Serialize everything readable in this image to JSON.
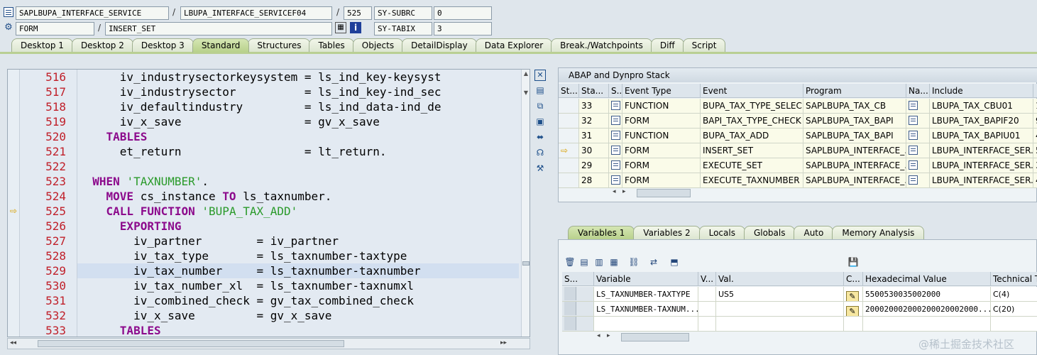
{
  "header": {
    "row1": {
      "program": "SAPLBUPA_INTERFACE_SERVICE",
      "include": "LBUPA_INTERFACE_SERVICEF04",
      "line": "525",
      "sysvar_name": "SY-SUBRC",
      "sysvar_value": "0"
    },
    "row2": {
      "event_type": "FORM",
      "event_name": "INSERT_SET",
      "sysvar_name": "SY-TABIX",
      "sysvar_value": "3"
    },
    "separator": "/"
  },
  "main_tabs": [
    "Desktop 1",
    "Desktop 2",
    "Desktop 3",
    "Standard",
    "Structures",
    "Tables",
    "Objects",
    "DetailDisplay",
    "Data Explorer",
    "Break./Watchpoints",
    "Diff",
    "Script"
  ],
  "active_main_tab": "Standard",
  "editor": {
    "current_line": "525",
    "cursor_line": "529",
    "lines": [
      {
        "no": "516",
        "code": "      iv_industrysectorkeysystem = ls_ind_key-keysyst"
      },
      {
        "no": "517",
        "code": "      iv_industrysector          = ls_ind_key-ind_sec"
      },
      {
        "no": "518",
        "code": "      iv_defaultindustry         = ls_ind_data-ind_de"
      },
      {
        "no": "519",
        "code": "      iv_x_save                  = gv_x_save"
      },
      {
        "no": "520",
        "code": "    TABLES"
      },
      {
        "no": "521",
        "code": "      et_return                  = lt_return."
      },
      {
        "no": "522",
        "code": ""
      },
      {
        "no": "523",
        "code": "  WHEN 'TAXNUMBER'."
      },
      {
        "no": "524",
        "code": "    MOVE cs_instance TO ls_taxnumber."
      },
      {
        "no": "525",
        "code": "    CALL FUNCTION 'BUPA_TAX_ADD'"
      },
      {
        "no": "526",
        "code": "      EXPORTING"
      },
      {
        "no": "527",
        "code": "        iv_partner        = iv_partner"
      },
      {
        "no": "528",
        "code": "        iv_tax_type       = ls_taxnumber-taxtype"
      },
      {
        "no": "529",
        "code": "        iv_tax_number     = ls_taxnumber-taxnumber"
      },
      {
        "no": "530",
        "code": "        iv_tax_number_xl  = ls_taxnumber-taxnumxl"
      },
      {
        "no": "531",
        "code": "        iv_combined_check = gv_tax_combined_check"
      },
      {
        "no": "532",
        "code": "        iv_x_save         = gv_x_save"
      },
      {
        "no": "533",
        "code": "      TABLES"
      }
    ]
  },
  "stack": {
    "title": "ABAP and Dynpro Stack",
    "columns": [
      "St...",
      "Sta...",
      "S...",
      "Event Type",
      "Event",
      "Program",
      "Na...",
      "Include"
    ],
    "rows": [
      {
        "level": "33",
        "type": "FUNCTION",
        "event": "BUPA_TAX_TYPE_SELEC...",
        "program": "SAPLBUPA_TAX_CB",
        "include": "LBUPA_TAX_CBU01",
        "more": "1"
      },
      {
        "level": "32",
        "type": "FORM",
        "event": "BAPI_TAX_TYPE_CHECK",
        "program": "SAPLBUPA_TAX_BAPI",
        "include": "LBUPA_TAX_BAPIF20",
        "more": "9"
      },
      {
        "level": "31",
        "type": "FUNCTION",
        "event": "BUPA_TAX_ADD",
        "program": "SAPLBUPA_TAX_BAPI",
        "include": "LBUPA_TAX_BAPIU01",
        "more": "4"
      },
      {
        "level": "30",
        "type": "FORM",
        "event": "INSERT_SET",
        "program": "SAPLBUPA_INTERFACE_...",
        "include": "LBUPA_INTERFACE_SER...",
        "more": "5",
        "current": true
      },
      {
        "level": "29",
        "type": "FORM",
        "event": "EXECUTE_SET",
        "program": "SAPLBUPA_INTERFACE_...",
        "include": "LBUPA_INTERFACE_SER...",
        "more": "3"
      },
      {
        "level": "28",
        "type": "FORM",
        "event": "EXECUTE_TAXNUMBER",
        "program": "SAPLBUPA_INTERFACE_...",
        "include": "LBUPA_INTERFACE_SER...",
        "more": "4"
      }
    ]
  },
  "var_tabs": [
    "Variables 1",
    "Variables 2",
    "Locals",
    "Globals",
    "Auto",
    "Memory Analysis"
  ],
  "active_var_tab": "Variables 1",
  "variables": {
    "columns": [
      "S...",
      "Variable",
      "V...",
      "Val.",
      "C...",
      "Hexadecimal Value",
      "Technical Type"
    ],
    "rows": [
      {
        "variable": "LS_TAXNUMBER-TAXTYPE",
        "value": "US5",
        "hex": "5500530035002000",
        "type": "C(4)"
      },
      {
        "variable": "LS_TAXNUMBER-TAXNUM...",
        "value": "",
        "hex": "200020002000200020002000...",
        "type": "C(20)"
      }
    ]
  },
  "watermark": "@稀土掘金技术社区"
}
